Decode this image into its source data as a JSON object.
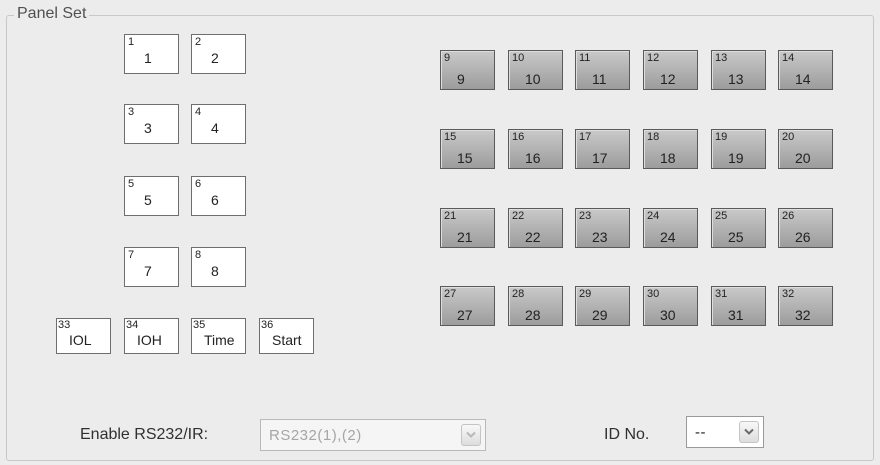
{
  "panel": {
    "title": "Panel Set"
  },
  "white_buttons": [
    {
      "index": "1",
      "label": "1"
    },
    {
      "index": "2",
      "label": "2"
    },
    {
      "index": "3",
      "label": "3"
    },
    {
      "index": "4",
      "label": "4"
    },
    {
      "index": "5",
      "label": "5"
    },
    {
      "index": "6",
      "label": "6"
    },
    {
      "index": "7",
      "label": "7"
    },
    {
      "index": "8",
      "label": "8"
    }
  ],
  "gray_buttons": [
    {
      "index": "9",
      "label": "9"
    },
    {
      "index": "10",
      "label": "10"
    },
    {
      "index": "11",
      "label": "11"
    },
    {
      "index": "12",
      "label": "12"
    },
    {
      "index": "13",
      "label": "13"
    },
    {
      "index": "14",
      "label": "14"
    },
    {
      "index": "15",
      "label": "15"
    },
    {
      "index": "16",
      "label": "16"
    },
    {
      "index": "17",
      "label": "17"
    },
    {
      "index": "18",
      "label": "18"
    },
    {
      "index": "19",
      "label": "19"
    },
    {
      "index": "20",
      "label": "20"
    },
    {
      "index": "21",
      "label": "21"
    },
    {
      "index": "22",
      "label": "22"
    },
    {
      "index": "23",
      "label": "23"
    },
    {
      "index": "24",
      "label": "24"
    },
    {
      "index": "25",
      "label": "25"
    },
    {
      "index": "26",
      "label": "26"
    },
    {
      "index": "27",
      "label": "27"
    },
    {
      "index": "28",
      "label": "28"
    },
    {
      "index": "29",
      "label": "29"
    },
    {
      "index": "30",
      "label": "30"
    },
    {
      "index": "31",
      "label": "31"
    },
    {
      "index": "32",
      "label": "32"
    }
  ],
  "function_buttons": [
    {
      "index": "33",
      "label": "IOL"
    },
    {
      "index": "34",
      "label": "IOH"
    },
    {
      "index": "35",
      "label": "Time"
    },
    {
      "index": "36",
      "label": "Start"
    }
  ],
  "rs232": {
    "label": "Enable RS232/IR:",
    "value": "RS232(1),(2)",
    "enabled": false
  },
  "id_no": {
    "label": "ID No.",
    "value": "--"
  },
  "icons": {
    "dropdown_arrow": "chevron-down-icon"
  },
  "colors": {
    "background": "#ececec",
    "gray_button_top": "#c9c9c9",
    "gray_button_bottom": "#9c9c9c",
    "white_button": "#ffffff",
    "disabled_text": "#a6a6a6"
  }
}
